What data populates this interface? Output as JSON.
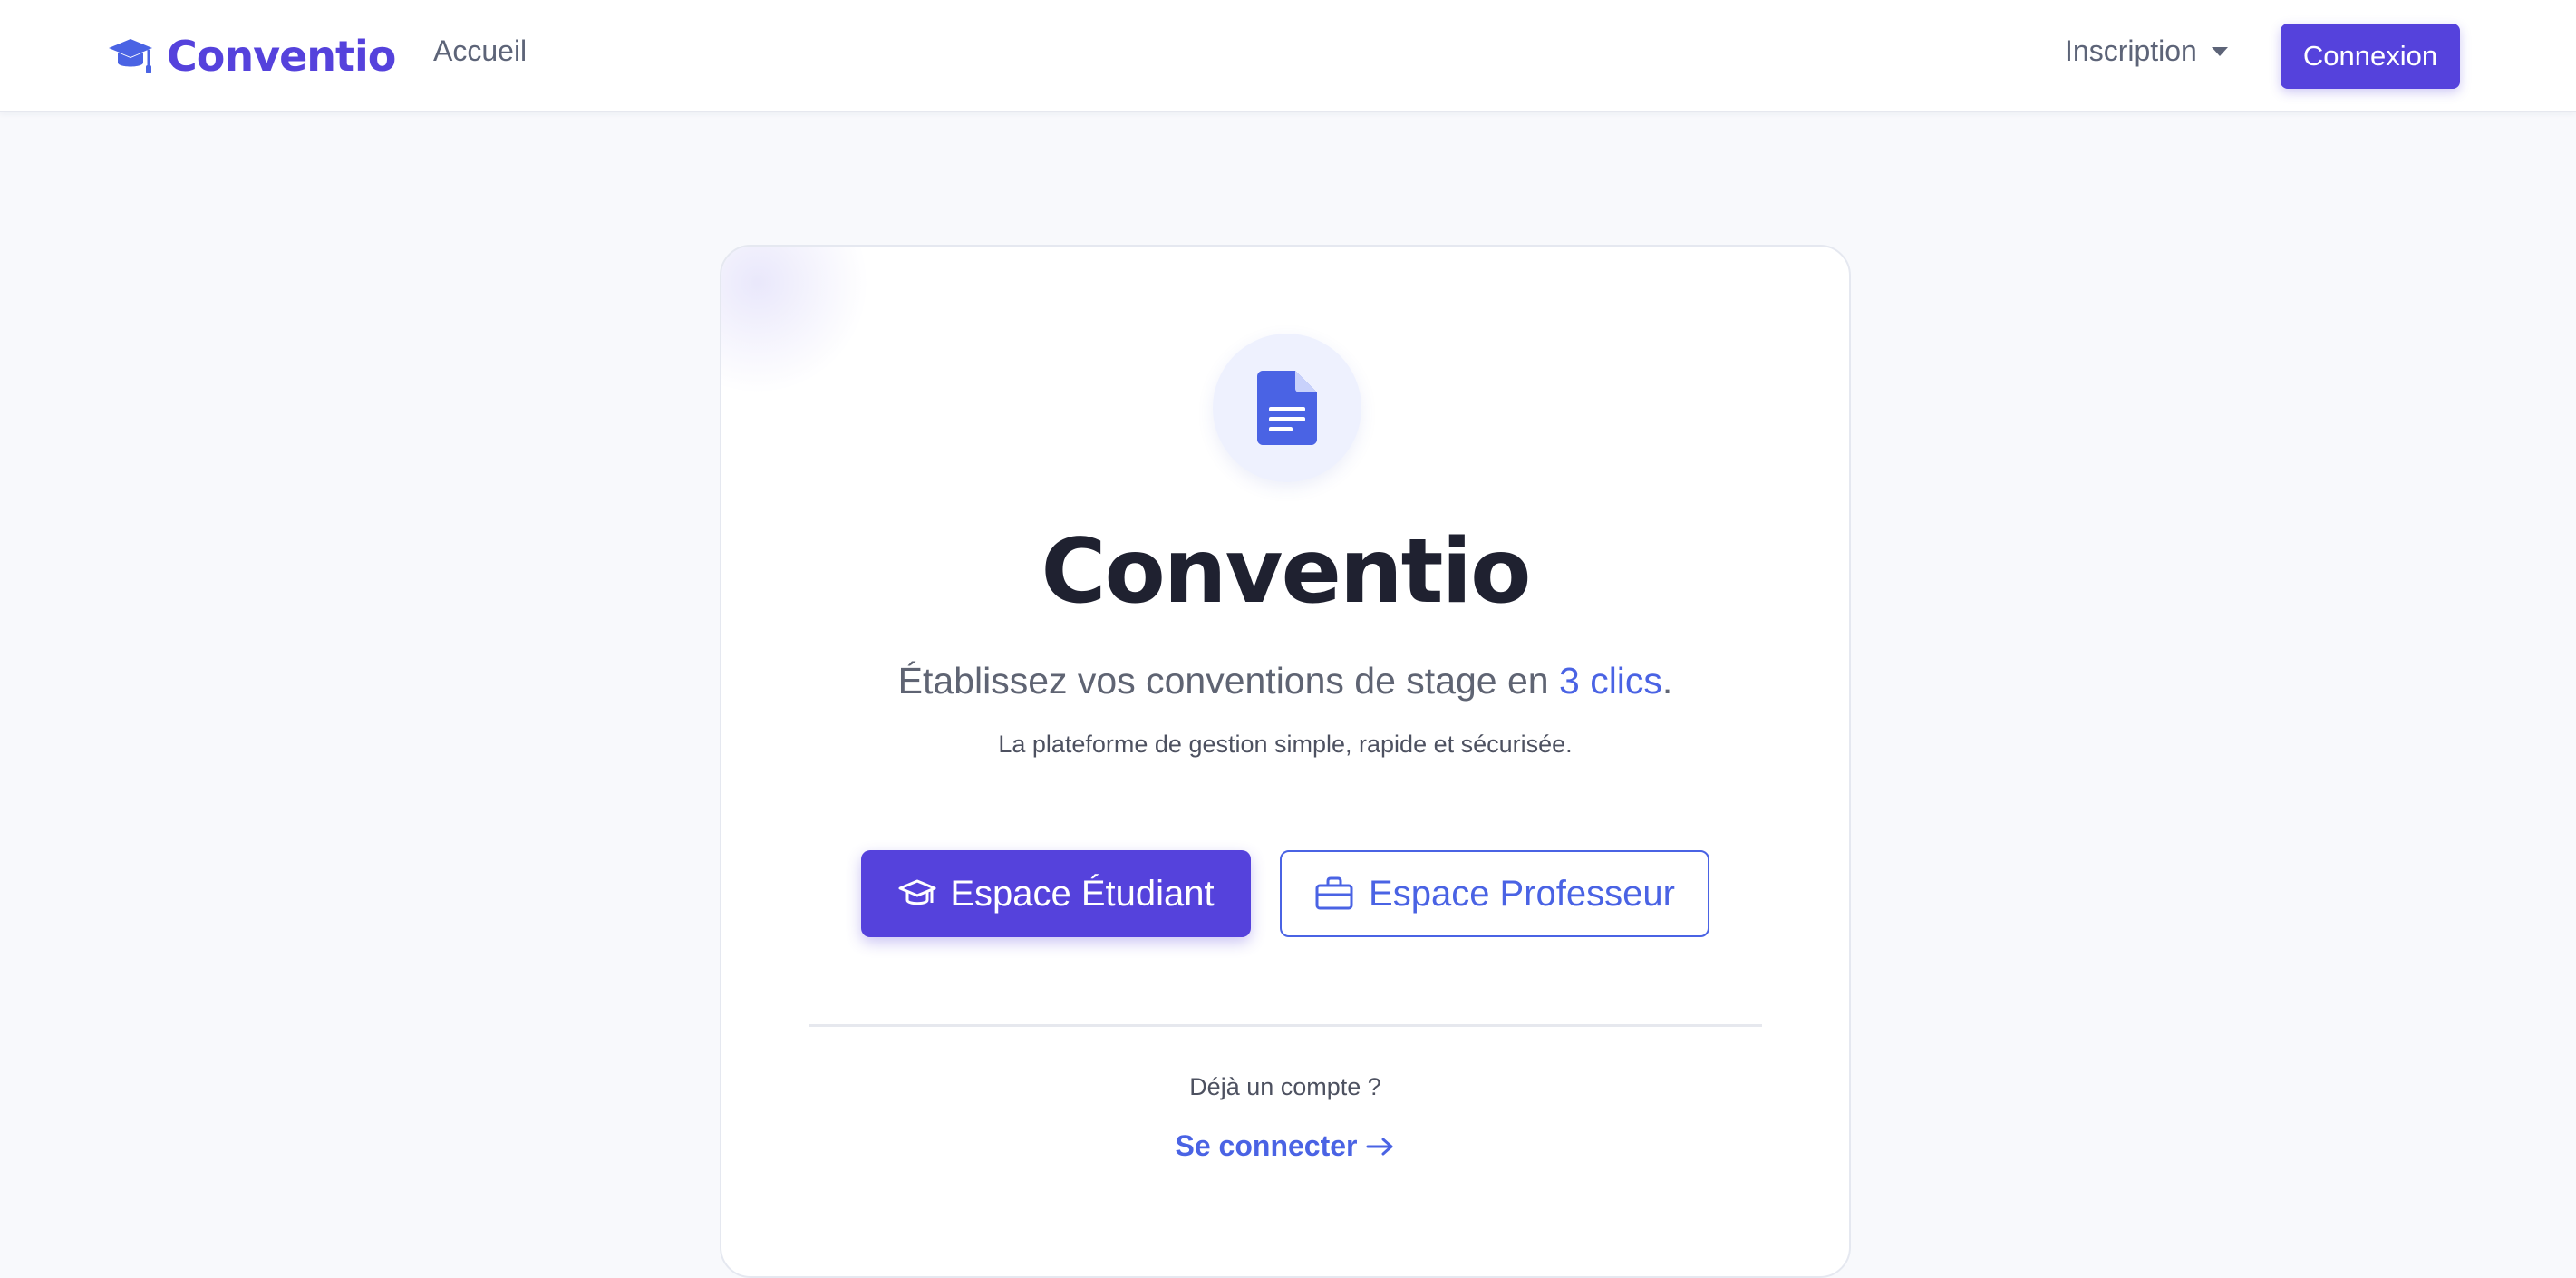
{
  "navbar": {
    "brand": "Conventio",
    "brand_icon": "graduation-cap-icon",
    "home_link": "Accueil",
    "signup_dropdown": "Inscription",
    "login_button": "Connexion"
  },
  "hero": {
    "icon": "document-icon",
    "title": "Conventio",
    "tagline_prefix": "Établissez vos conventions de stage en ",
    "tagline_accent": "3 clics",
    "tagline_suffix": ".",
    "subtagline": "La plateforme de gestion simple, rapide et sécurisée.",
    "student_button": "Espace Étudiant",
    "student_button_icon": "graduation-cap-icon",
    "professor_button": "Espace Professeur",
    "professor_button_icon": "briefcase-icon",
    "have_account": "Déjà un compte ?",
    "signin_link": "Se connecter",
    "signin_link_icon": "arrow-right-icon"
  },
  "colors": {
    "primary": "#5542dc",
    "accent": "#4a63e4",
    "background": "#f8f9fc",
    "text_dark": "#1f2130"
  }
}
